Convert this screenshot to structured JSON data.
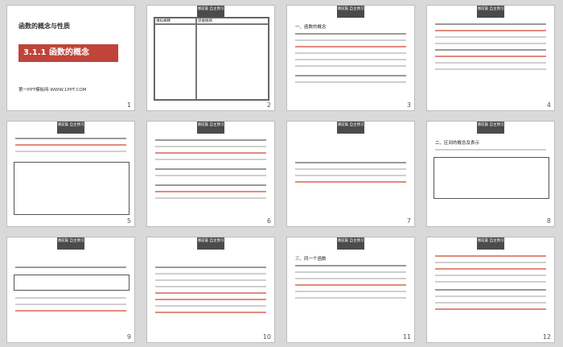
{
  "slides": [
    {
      "number": "1",
      "title": "函数的概念与性质",
      "section": "3.1.1 函数的概念",
      "footer": "第一PPT模板网-WWW.1PPT.COM"
    },
    {
      "number": "2",
      "header_left": "课标阐释",
      "header_right": "思维脉络"
    },
    {
      "number": "3",
      "heading": "一、函数的概念"
    },
    {
      "number": "4"
    },
    {
      "number": "5"
    },
    {
      "number": "6"
    },
    {
      "number": "7"
    },
    {
      "number": "8",
      "heading": "二、区间的概念及表示"
    },
    {
      "number": "9"
    },
    {
      "number": "10"
    },
    {
      "number": "11",
      "heading": "三、同一个函数"
    },
    {
      "number": "12"
    }
  ],
  "tag_label": "课前篇 自主预习",
  "colors": {
    "accent": "#c0443a",
    "tag": "#4b4b4b"
  }
}
